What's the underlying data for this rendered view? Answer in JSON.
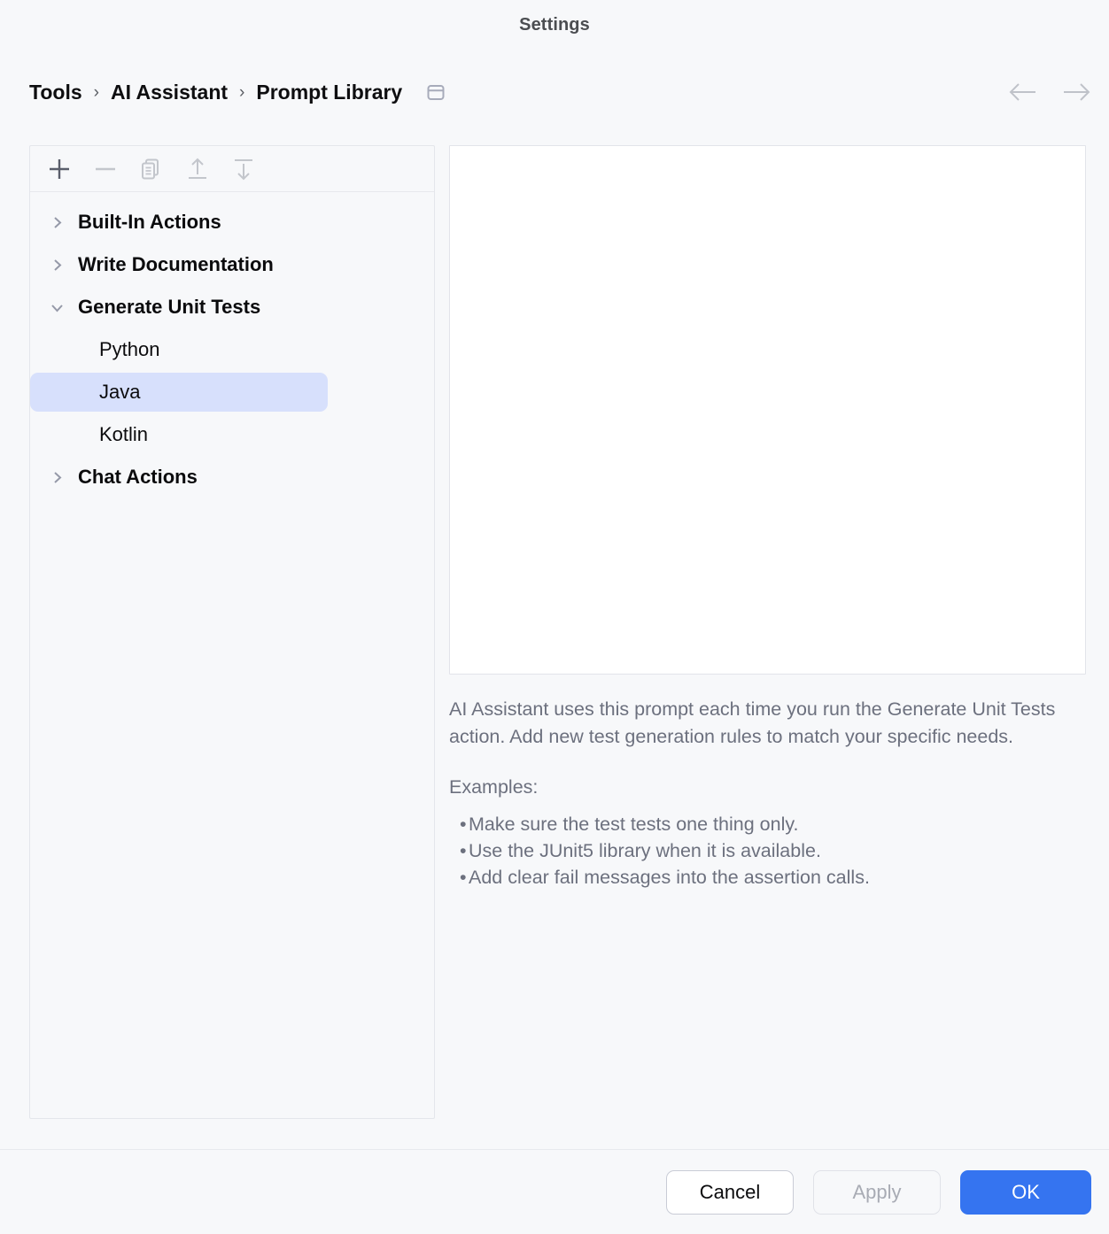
{
  "window": {
    "title": "Settings"
  },
  "breadcrumb": {
    "items": [
      "Tools",
      "AI Assistant",
      "Prompt Library"
    ],
    "separator": "›",
    "panel_icon": "window-panel-icon"
  },
  "nav": {
    "back_icon": "arrow-left-icon",
    "forward_icon": "arrow-right-icon",
    "back_enabled": false,
    "forward_enabled": false
  },
  "tree_toolbar": {
    "buttons": [
      {
        "name": "add",
        "icon": "plus-icon",
        "enabled": true
      },
      {
        "name": "remove",
        "icon": "minus-icon",
        "enabled": false
      },
      {
        "name": "duplicate",
        "icon": "copy-icon",
        "enabled": false
      },
      {
        "name": "import",
        "icon": "arrow-up-import-icon",
        "enabled": false
      },
      {
        "name": "export",
        "icon": "arrow-down-export-icon",
        "enabled": false
      }
    ]
  },
  "tree": {
    "nodes": [
      {
        "label": "Built-In Actions",
        "type": "group",
        "expanded": false,
        "selected": false
      },
      {
        "label": "Write Documentation",
        "type": "group",
        "expanded": false,
        "selected": false
      },
      {
        "label": "Generate Unit Tests",
        "type": "group",
        "expanded": true,
        "selected": false
      },
      {
        "label": "Python",
        "type": "child",
        "selected": false
      },
      {
        "label": "Java",
        "type": "child",
        "selected": true
      },
      {
        "label": "Kotlin",
        "type": "child",
        "selected": false
      },
      {
        "label": "Chat Actions",
        "type": "group",
        "expanded": false,
        "selected": false
      }
    ]
  },
  "editor": {
    "value": "",
    "placeholder": ""
  },
  "description": {
    "paragraph": "AI Assistant uses this prompt each time you run the Generate Unit Tests action. Add new test generation rules to match your specific needs.",
    "examples_label": "Examples:",
    "bullet_char": "•",
    "examples": [
      "Make sure the test tests one thing only.",
      "Use the JUnit5 library when it is available.",
      "Add clear fail messages into the assertion calls."
    ]
  },
  "footer": {
    "cancel_label": "Cancel",
    "apply_label": "Apply",
    "apply_enabled": false,
    "ok_label": "OK"
  },
  "colors": {
    "background": "#F7F8FA",
    "accent_blue": "#3574F0",
    "selection": "#D7E0FC",
    "muted_text": "#6C707E",
    "border": "#E4E6EB"
  }
}
